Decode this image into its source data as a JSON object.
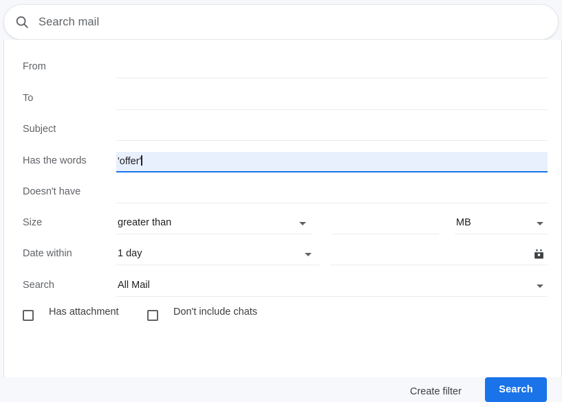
{
  "search_bar": {
    "icon": "search-icon",
    "placeholder": "Search mail",
    "value": ""
  },
  "form": {
    "fields": [
      {
        "label": "From",
        "value": ""
      },
      {
        "label": "To",
        "value": ""
      },
      {
        "label": "Subject",
        "value": ""
      },
      {
        "label": "Has the words",
        "value": "'offer'",
        "focused": true
      },
      {
        "label": "Doesn't have",
        "value": ""
      }
    ],
    "size": {
      "label": "Size",
      "operator": "greater than",
      "amount": "",
      "unit": "MB"
    },
    "date_within": {
      "label": "Date within",
      "value": "1 day",
      "date": "",
      "icon": "calendar-icon"
    },
    "search_scope": {
      "label": "Search",
      "value": "All Mail"
    },
    "checkboxes": [
      {
        "label": "Has attachment",
        "checked": false
      },
      {
        "label": "Don't include chats",
        "checked": false
      }
    ]
  },
  "actions": {
    "create_filter_label": "Create filter",
    "search_label": "Search"
  },
  "colors": {
    "accent": "#1a73e8",
    "focus_fill": "#e9f0fd",
    "label_text": "#5f6368",
    "value_text": "#202124"
  }
}
